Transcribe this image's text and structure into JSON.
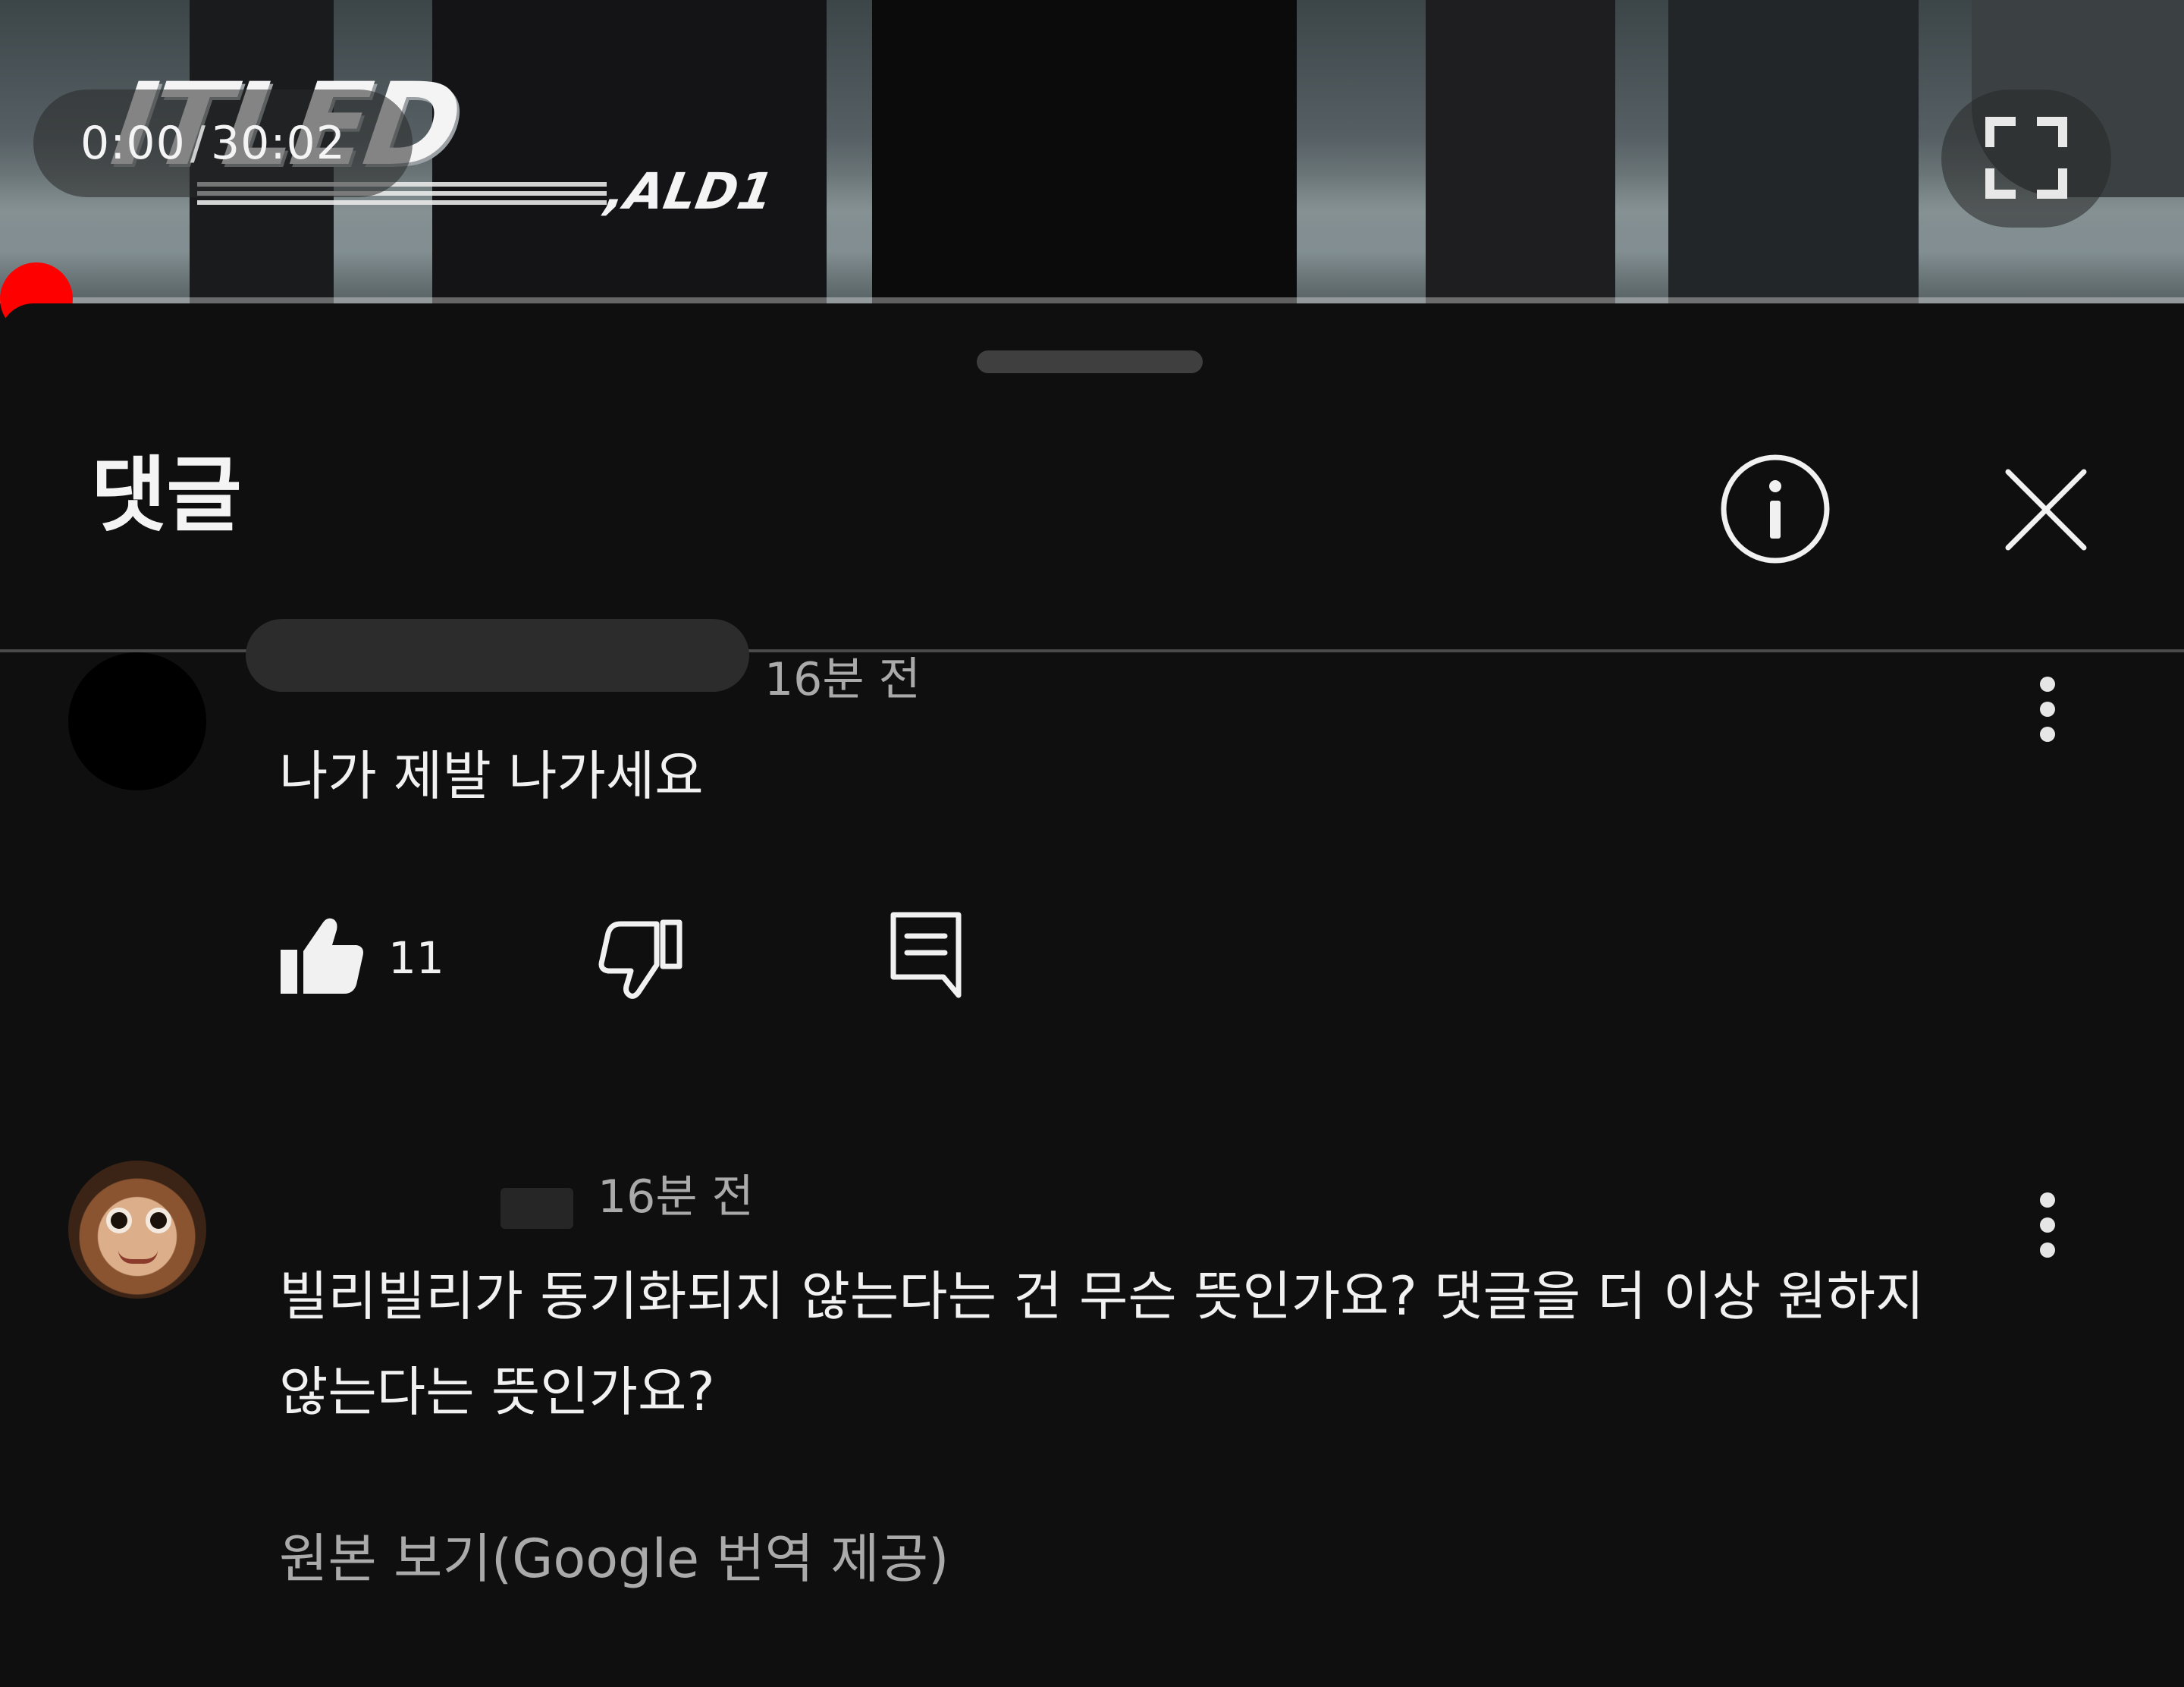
{
  "player": {
    "current_time": "0:00",
    "separator": "/",
    "duration": "30:02",
    "progress_fraction": 0.0,
    "video_title_art": "ITLED",
    "video_title_art_sub": ",ALD1",
    "fullscreen_icon": "fullscreen-icon",
    "accent_color": "#ff0000"
  },
  "sheet": {
    "title": "댓글",
    "info_icon": "info-icon",
    "close_icon": "close-icon"
  },
  "comments": [
    {
      "timestamp": "16분 전",
      "text": "나가 제발 나가세요",
      "likes": "11",
      "menu_icon": "more-vert-icon"
    },
    {
      "timestamp": "16분 전",
      "text": "빌리빌리가 동기화되지 않는다는 건 무슨 뜻인가요? 댓글을 더 이상 원하지 않는다는 뜻인가요?",
      "translate_link": "원본 보기(Google 번역 제공)",
      "menu_icon": "more-vert-icon"
    }
  ],
  "colors": {
    "background": "#0f0f0f",
    "secondary_text": "#aaaaaa",
    "primary_text": "#f1f1f1"
  }
}
